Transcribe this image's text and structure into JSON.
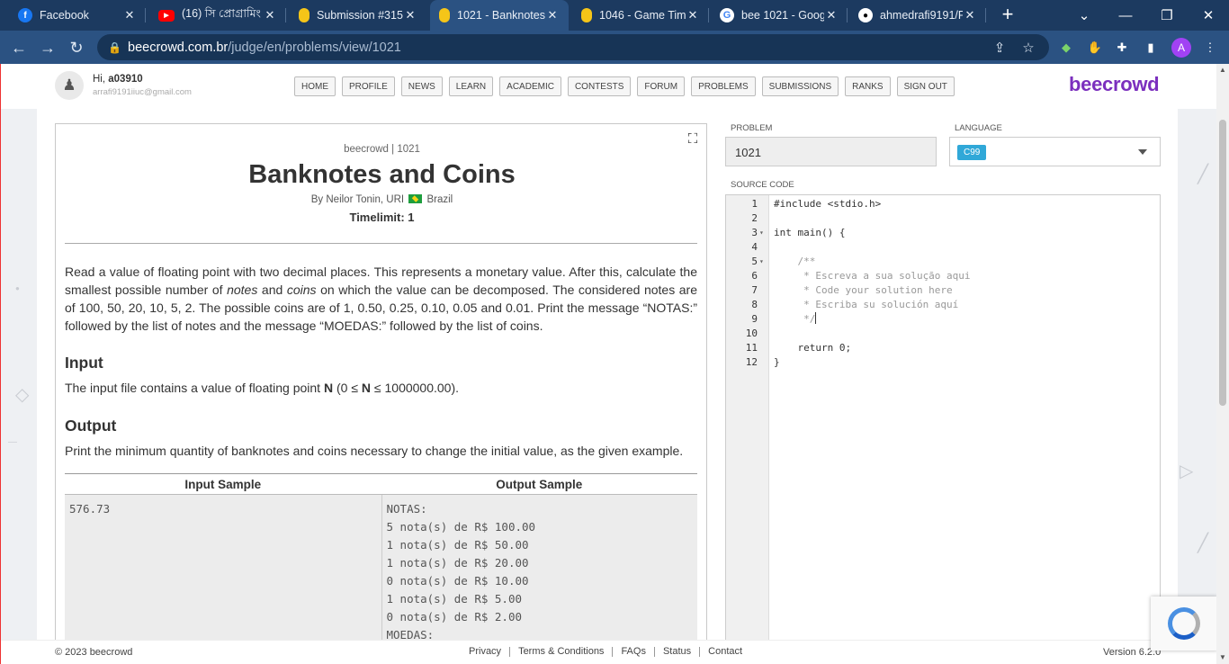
{
  "tabs": [
    {
      "title": "Facebook",
      "icon": "facebook-icon"
    },
    {
      "title": "(16) সি প্রোগ্রামিং",
      "icon": "youtube-icon"
    },
    {
      "title": "Submission #315",
      "icon": "beecrowd-icon"
    },
    {
      "title": "1021 - Banknotes",
      "icon": "beecrowd-icon"
    },
    {
      "title": "1046 - Game Tim",
      "icon": "beecrowd-icon"
    },
    {
      "title": "bee 1021 - Googl",
      "icon": "google-icon"
    },
    {
      "title": "ahmedrafi9191/P",
      "icon": "github-icon"
    }
  ],
  "address": {
    "domain": "beecrowd.com.br",
    "path": "/judge/en/problems/view/1021"
  },
  "profile_initial": "A",
  "header": {
    "greeting": "Hi,",
    "username": "a03910",
    "email": "arrafi9191iiuc@gmail.com",
    "menu": [
      "HOME",
      "PROFILE",
      "NEWS",
      "LEARN",
      "ACADEMIC",
      "CONTESTS",
      "FORUM",
      "PROBLEMS",
      "SUBMISSIONS",
      "RANKS",
      "SIGN OUT"
    ],
    "logo": "beecrowd"
  },
  "problem": {
    "crumb": "beecrowd | 1021",
    "title": "Banknotes and Coins",
    "by_prefix": "By Neilor Tonin, URI",
    "country": "Brazil",
    "timelimit": "Timelimit: 1",
    "desc_part1": "Read a value of floating point with two decimal places. This represents a monetary value. After this, calculate the smallest possible number of ",
    "desc_notes": "notes",
    "desc_and": " and ",
    "desc_coins": "coins",
    "desc_part2": " on which the value can be decomposed. The considered notes are of 100, 50, 20, 10, 5, 2. The possible coins are of 1, 0.50, 0.25, 0.10, 0.05 and 0.01. Print the message “NOTAS:” followed by the list of notes and the message “MOEDAS:” followed by the list of coins.",
    "input_heading": "Input",
    "input_text_a": "The input file contains a value of floating point ",
    "input_n": "N",
    "input_text_b": " (0 ≤ ",
    "input_text_c": " ≤ 1000000.00).",
    "output_heading": "Output",
    "output_text": "Print the minimum quantity of banknotes and coins necessary to change the initial value, as the given example.",
    "input_sample_label": "Input Sample",
    "output_sample_label": "Output Sample",
    "input_sample": "576.73",
    "output_sample": "NOTAS:\n5 nota(s) de R$ 100.00\n1 nota(s) de R$ 50.00\n1 nota(s) de R$ 20.00\n0 nota(s) de R$ 10.00\n1 nota(s) de R$ 5.00\n0 nota(s) de R$ 2.00\nMOEDAS:"
  },
  "editor": {
    "problem_label": "PROBLEM",
    "problem_value": "1021",
    "language_label": "LANGUAGE",
    "language_value": "C99",
    "source_label": "SOURCE CODE",
    "lines": [
      {
        "n": "1",
        "text": "#include <stdio.h>",
        "fold": "",
        "comment": false
      },
      {
        "n": "2",
        "text": "",
        "fold": "",
        "comment": false
      },
      {
        "n": "3",
        "text": "int main() {",
        "fold": "▾",
        "comment": false
      },
      {
        "n": "4",
        "text": "",
        "fold": "",
        "comment": false
      },
      {
        "n": "5",
        "text": "    /**",
        "fold": "▾",
        "comment": true
      },
      {
        "n": "6",
        "text": "     * Escreva a sua solução aqui",
        "fold": "",
        "comment": true
      },
      {
        "n": "7",
        "text": "     * Code your solution here",
        "fold": "",
        "comment": true
      },
      {
        "n": "8",
        "text": "     * Escriba su solución aquí",
        "fold": "",
        "comment": true
      },
      {
        "n": "9",
        "text": "     */",
        "fold": "",
        "comment": true
      },
      {
        "n": "10",
        "text": "",
        "fold": "",
        "comment": false
      },
      {
        "n": "11",
        "text": "    return 0;",
        "fold": "",
        "comment": false
      },
      {
        "n": "12",
        "text": "}",
        "fold": "",
        "comment": false
      }
    ]
  },
  "footer": {
    "copyright": "© 2023 beecrowd",
    "links": [
      "Privacy",
      "Terms & Conditions",
      "FAQs",
      "Status",
      "Contact"
    ],
    "version": "Version 6.2.0"
  }
}
